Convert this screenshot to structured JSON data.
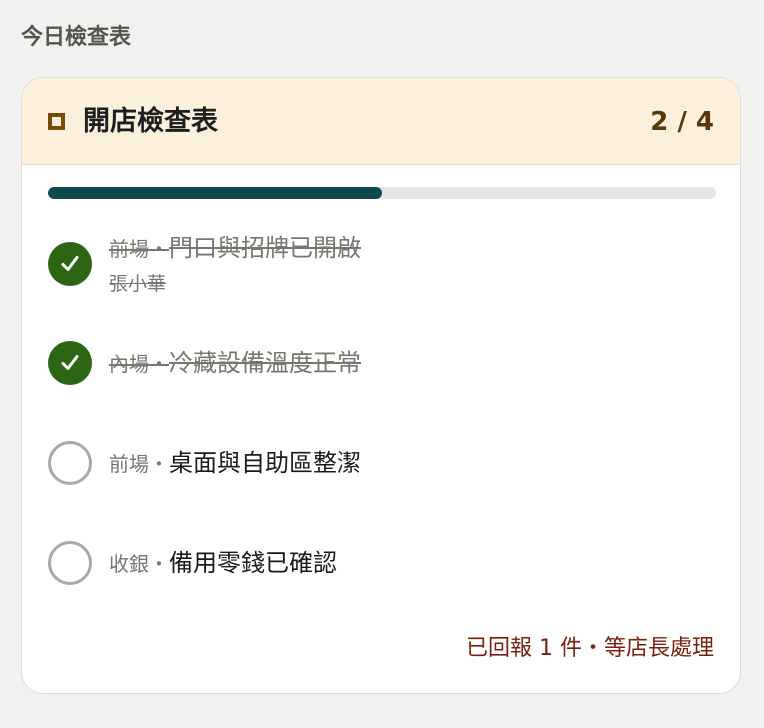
{
  "page_heading": "今日檢查表",
  "card": {
    "title": "開店檢查表",
    "count": "2 / 4",
    "progress_fraction": 0.5,
    "items": [
      {
        "area": "前場",
        "separator": "・",
        "task": "門口與招牌已開啟",
        "assignee": "張小華",
        "done": true
      },
      {
        "area": "內場",
        "separator": "・",
        "task": "冷藏設備溫度正常",
        "done": true
      },
      {
        "area": "前場",
        "separator": "・",
        "task": "桌面與自助區整潔",
        "done": false
      },
      {
        "area": "收銀",
        "separator": "・",
        "task": "備用零錢已確認",
        "done": false
      }
    ],
    "footer_note": "已回報 1 件・等店長處理"
  },
  "colors": {
    "accent_dark": "#0d4a4f",
    "done_green": "#2c6614",
    "header_bg": "#fbf0db",
    "count_brown": "#5a3608",
    "note_red": "#7a1f10"
  },
  "icons": {
    "header": "checklist-square-icon",
    "done": "checkmark-icon",
    "todo": "empty-circle-icon"
  }
}
